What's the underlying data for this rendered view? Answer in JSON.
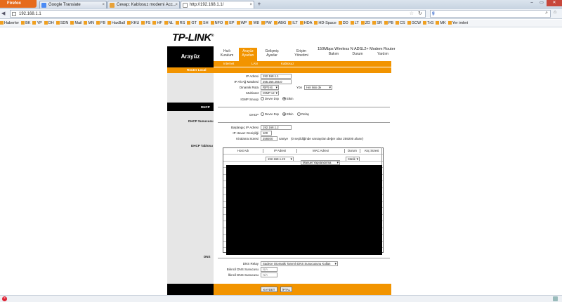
{
  "browser": {
    "app_button": "Firefox",
    "tabs": [
      {
        "label": "Google Translate"
      },
      {
        "label": "Cevap: Kablosuz modemi Acc..."
      },
      {
        "label": "http://192.168.1.1/"
      }
    ],
    "new_tab": "+",
    "url": "192.168.1.1",
    "search_engine": "g",
    "bookmarks": [
      "Haberler",
      "BK",
      "YP",
      "DH",
      "SDN",
      "Mail",
      "MN",
      "FB",
      "HaxBall",
      "KKU",
      "FS",
      "HF",
      "NL",
      "RS",
      "GT",
      "SH",
      "NFO",
      "EP",
      "WP",
      "W8",
      "PW",
      "ABG",
      "ILT",
      "HDA",
      "HD-Space",
      "DD",
      "LT",
      "ZD",
      "SR",
      "PB",
      "CS",
      "GCW",
      "TrG",
      "MK",
      "Yer imleri"
    ]
  },
  "header": {
    "brand": "TP-LINK",
    "model": "150Mbps Wireless N ADSL2+ Modem Router",
    "section_title": "Arayüz"
  },
  "menu": {
    "items": [
      {
        "label": "Hızlı Kurulum"
      },
      {
        "label": "Arayüz Ayarları"
      },
      {
        "label": "Gelişmiş Ayarlar"
      },
      {
        "label": "Erişim Yönetimi"
      },
      {
        "label": "Bakım"
      },
      {
        "label": "Durum"
      },
      {
        "label": "Yardım"
      }
    ],
    "submenu": [
      "Internet",
      "LAN",
      "Kablosuz"
    ]
  },
  "router": {
    "label": "Router Local",
    "ip_label": "IP Adresi",
    "ip_value": "192.168.1.1",
    "mask_label": "IP Alt Ağ Maskesi",
    "mask_value": "255.255.255.0",
    "dynamic_route_label": "Dinamik Rota",
    "dynamic_route_value": "RIP2-B",
    "direction_label": "Yön",
    "direction_value": "Her ikisi de",
    "multicast_label": "Multicast",
    "multicast_value": "IGMP v2",
    "igmp_label": "IGMP Snoop",
    "off_label": "Devre Dışı",
    "on_label": "Etkin"
  },
  "dhcp": {
    "section": "DHCP",
    "dhcp_label": "DHCP",
    "opt_off": "Devre Dışı",
    "opt_on": "Etkin",
    "opt_relay": "Relay",
    "server_section": "DHCP Sunucusu",
    "start_ip_label": "Başlangıç IP Adresi",
    "start_ip_value": "192.168.1.2",
    "pool_label": "IP Havuz Genişliği",
    "pool_value": "100",
    "lease_label": "Kiralama Süresi",
    "lease_value": "259200",
    "lease_unit": "saniye",
    "lease_note": "(0 seçildiğinde varsayılan değer olan 259200 alanır)",
    "table_section": "DHCP Tablosu",
    "table_headers": [
      "Host Adı",
      "IP Adresi",
      "MAC Adresi",
      "Durum",
      "Atıç Süresi"
    ],
    "row_ip": "192.168.1.22",
    "row_mac": "Manuel Yapılandırma",
    "row_status": "Statik"
  },
  "dns": {
    "section": "DNS",
    "relay_label": "DNS Relay",
    "relay_value": "Sadece Otomatik Tanımlı DNS Sunucusunu Kullan",
    "primary_label": "Birincil DNS Sunucusu",
    "primary_value": "N/A",
    "secondary_label": "İkincil DNS Sunucusu",
    "secondary_value": "N/A"
  },
  "actions": {
    "save": "KAYDET",
    "cancel": "İPTAL"
  },
  "colors": {
    "accent": "#f29400",
    "dark": "#000000"
  }
}
